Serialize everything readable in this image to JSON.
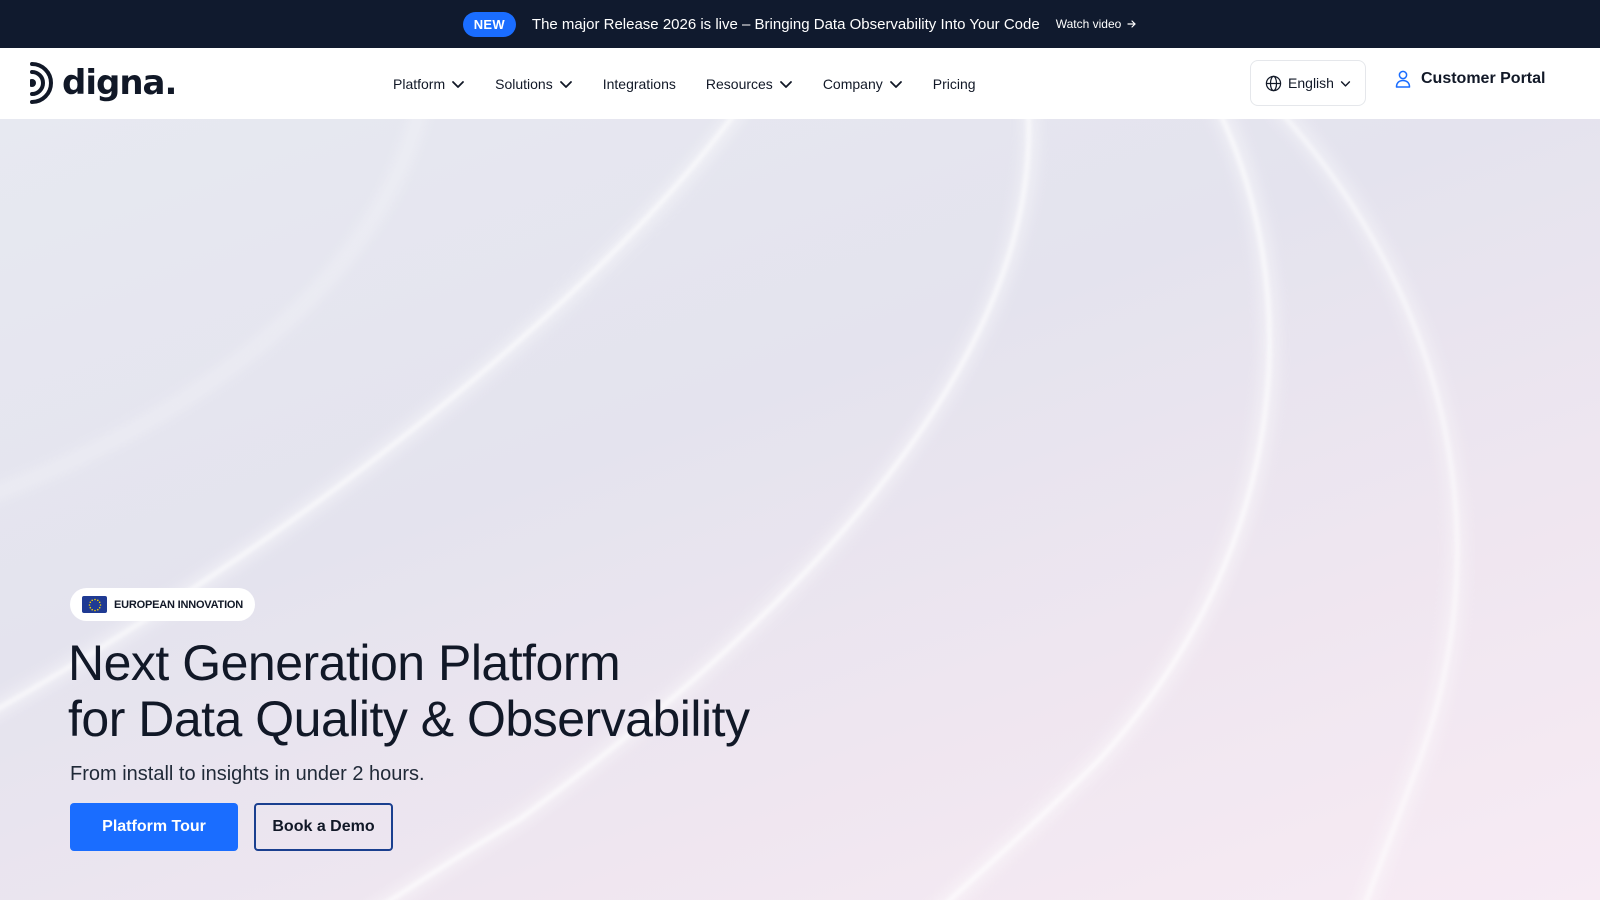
{
  "announcement": {
    "badge": "NEW",
    "message": "The major Release 2026 is live – Bringing Data Observability Into Your Code",
    "link_label": "Watch video"
  },
  "nav": {
    "logo_text": "digna.",
    "items": [
      {
        "label": "Platform",
        "has_dropdown": true
      },
      {
        "label": "Solutions",
        "has_dropdown": true
      },
      {
        "label": "Integrations",
        "has_dropdown": false
      },
      {
        "label": "Resources",
        "has_dropdown": true
      },
      {
        "label": "Company",
        "has_dropdown": true
      },
      {
        "label": "Pricing",
        "has_dropdown": false
      }
    ],
    "language": "English",
    "portal_label": "Customer Portal"
  },
  "hero": {
    "badge": "EUROPEAN INNOVATION",
    "headline_line1": "Next Generation Platform",
    "headline_line2": "for Data Quality & Observability",
    "subline": "From install to insights in under 2 hours.",
    "primary_cta": "Platform Tour",
    "secondary_cta": "Book a Demo"
  },
  "colors": {
    "accent": "#1a6dff",
    "topbar": "#101a2e",
    "portal_icon": "#1a6dff"
  },
  "icons": {
    "globe": "globe-icon",
    "user": "user-icon",
    "chevron": "chevron-down-icon",
    "arrow": "arrow-right-icon",
    "flag": "eu-flag-icon"
  }
}
